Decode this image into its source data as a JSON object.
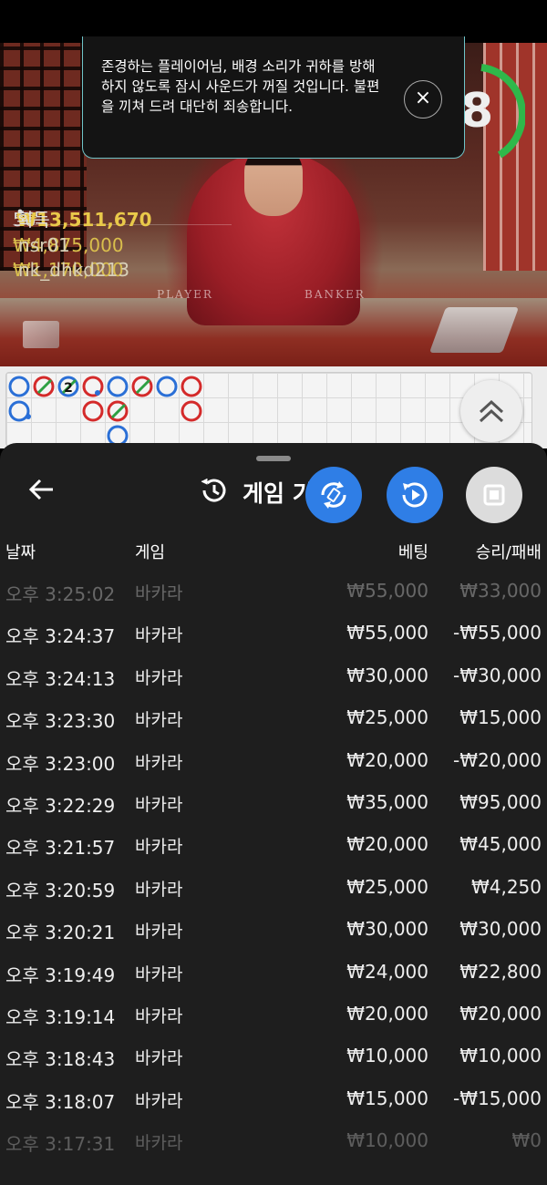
{
  "toast": {
    "message": "존경하는 플레이어님, 배경 소리가 귀하를 방해하지 않도록 잠시 사운드가 꺼질 것입니다. 불편을 끼쳐 드려 대단히 죄송합니다.",
    "close_label": "×"
  },
  "timer": {
    "value": "8",
    "progress": 0.7
  },
  "table": {
    "player_label": "PLAYER",
    "banker_label": "BANKER"
  },
  "winners": {
    "count": "56",
    "total": "₩13,511,670",
    "total_suffix": "획득",
    "entries": [
      {
        "amount": "₩4,875,000",
        "nick": "nsr01"
      },
      {
        "amount": "₩1,170,000",
        "nick": "nk_dhkd213"
      }
    ]
  },
  "roadmap": {
    "badge": "2"
  },
  "history": {
    "title": "게임 기",
    "columns": {
      "date": "날짜",
      "game": "게임",
      "bet": "베팅",
      "result": "승리/패배"
    },
    "rows": [
      {
        "time": "오후 3:25:02",
        "game": "바카라",
        "bet": "₩55,000",
        "result": "₩33,000"
      },
      {
        "time": "오후 3:24:37",
        "game": "바카라",
        "bet": "₩55,000",
        "result": "-₩55,000"
      },
      {
        "time": "오후 3:24:13",
        "game": "바카라",
        "bet": "₩30,000",
        "result": "-₩30,000"
      },
      {
        "time": "오후 3:23:30",
        "game": "바카라",
        "bet": "₩25,000",
        "result": "₩15,000"
      },
      {
        "time": "오후 3:23:00",
        "game": "바카라",
        "bet": "₩20,000",
        "result": "-₩20,000"
      },
      {
        "time": "오후 3:22:29",
        "game": "바카라",
        "bet": "₩35,000",
        "result": "₩95,000"
      },
      {
        "time": "오후 3:21:57",
        "game": "바카라",
        "bet": "₩20,000",
        "result": "₩45,000"
      },
      {
        "time": "오후 3:20:59",
        "game": "바카라",
        "bet": "₩25,000",
        "result": "₩4,250"
      },
      {
        "time": "오후 3:20:21",
        "game": "바카라",
        "bet": "₩30,000",
        "result": "₩30,000"
      },
      {
        "time": "오후 3:19:49",
        "game": "바카라",
        "bet": "₩24,000",
        "result": "₩22,800"
      },
      {
        "time": "오후 3:19:14",
        "game": "바카라",
        "bet": "₩20,000",
        "result": "₩20,000"
      },
      {
        "time": "오후 3:18:43",
        "game": "바카라",
        "bet": "₩10,000",
        "result": "₩10,000"
      },
      {
        "time": "오후 3:18:07",
        "game": "바카라",
        "bet": "₩15,000",
        "result": "-₩15,000"
      },
      {
        "time": "오후 3:17:31",
        "game": "바카라",
        "bet": "₩10,000",
        "result": "₩0"
      }
    ]
  },
  "colors": {
    "accent_blue": "#2f7ee6",
    "toast_border": "#6fc4c8",
    "winner_gold": "#e9c94a"
  },
  "icons": [
    "back-arrow-icon",
    "history-icon",
    "rotate-icon",
    "replay-icon",
    "stop-icon",
    "chevron-up-icon",
    "close-icon",
    "person-icon"
  ]
}
